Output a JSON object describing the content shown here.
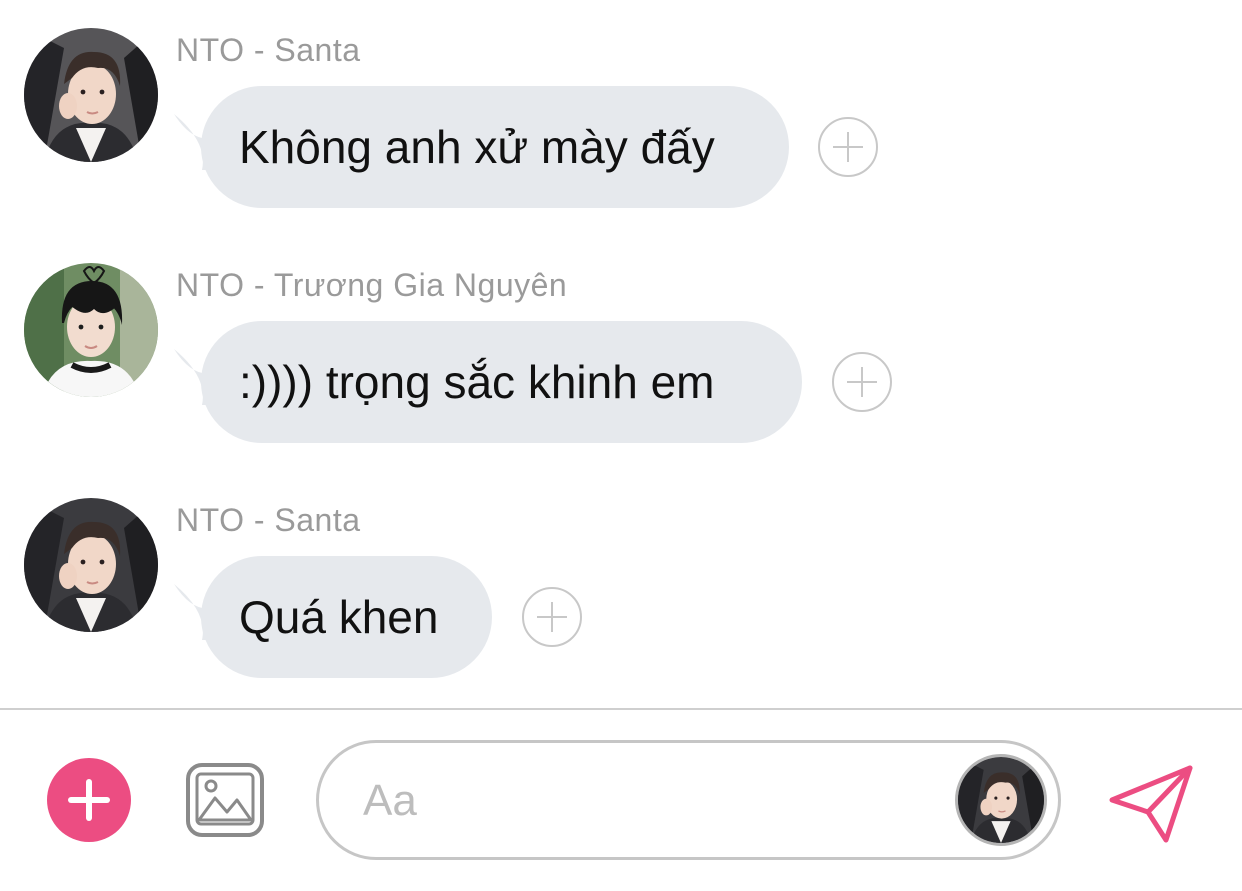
{
  "messages": [
    {
      "sender": "NTO - Santa",
      "text": "Không anh xử mày đấy",
      "avatar_icon": "santa-avatar"
    },
    {
      "sender": "NTO - Trương Gia Nguyên",
      "text": ":)))) trọng sắc khinh em",
      "avatar_icon": "truong-gia-nguyen-avatar"
    },
    {
      "sender": "NTO - Santa",
      "text": "Quá khen",
      "avatar_icon": "santa-avatar"
    }
  ],
  "composer": {
    "placeholder": "Aa",
    "plus_icon": "plus-icon",
    "image_icon": "image-icon",
    "send_icon": "send-icon",
    "accent_color": "#ec4d82"
  },
  "colors": {
    "bubble": "#e6e9ed",
    "sender_text": "#9a9a9a",
    "accent": "#ec4d82"
  }
}
